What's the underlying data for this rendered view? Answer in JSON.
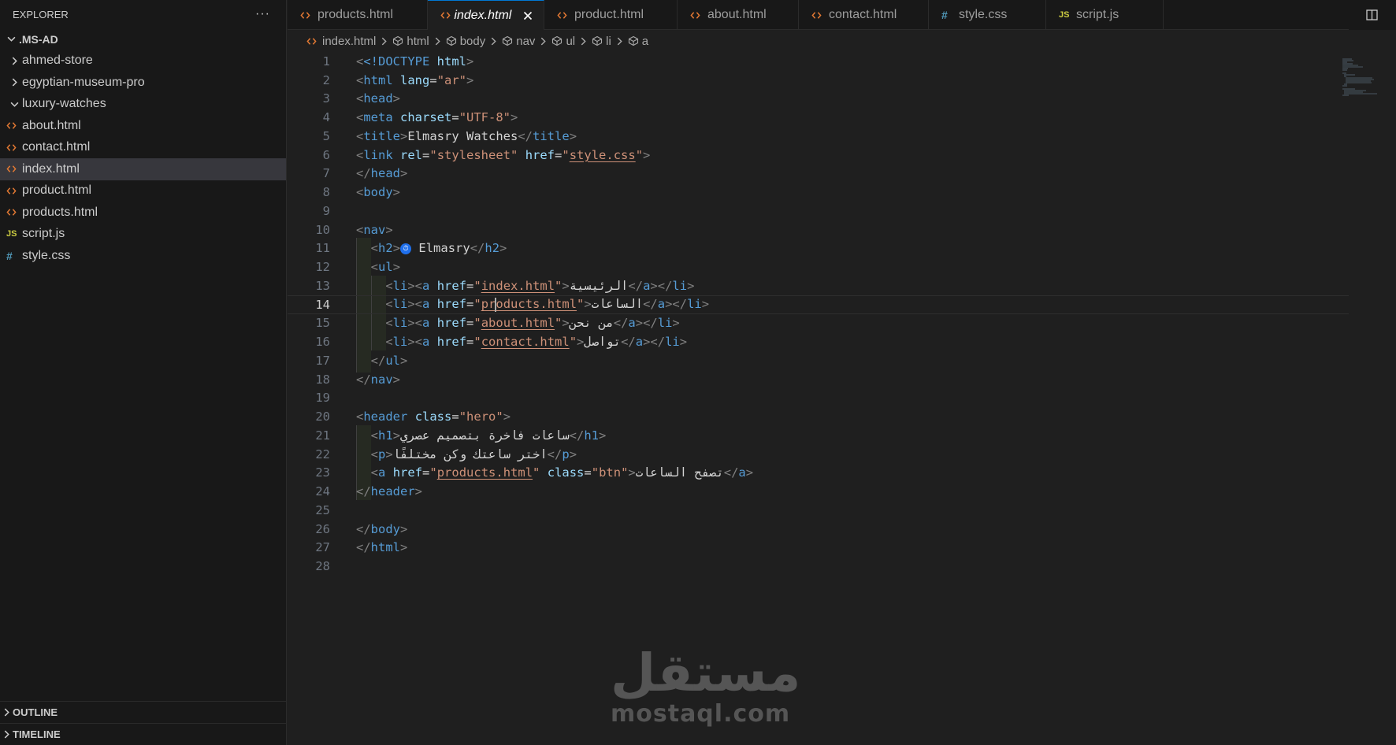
{
  "sidebar": {
    "title": "EXPLORER",
    "more": "···",
    "root": ".MS-AD",
    "folders": [
      {
        "label": "ahmed-store",
        "open": false
      },
      {
        "label": "egyptian-museum-pro",
        "open": false
      },
      {
        "label": "luxury-watches",
        "open": true
      }
    ],
    "files": [
      {
        "label": "about.html",
        "type": "html"
      },
      {
        "label": "contact.html",
        "type": "html"
      },
      {
        "label": "index.html",
        "type": "html",
        "active": true
      },
      {
        "label": "product.html",
        "type": "html"
      },
      {
        "label": "products.html",
        "type": "html"
      },
      {
        "label": "script.js",
        "type": "js"
      },
      {
        "label": "style.css",
        "type": "css"
      }
    ],
    "outline_label": "OUTLINE",
    "timeline_label": "TIMELINE"
  },
  "tabs": [
    {
      "label": "products.html",
      "type": "html"
    },
    {
      "label": "index.html",
      "type": "html",
      "active": true
    },
    {
      "label": "product.html",
      "type": "html"
    },
    {
      "label": "about.html",
      "type": "html"
    },
    {
      "label": "contact.html",
      "type": "html"
    },
    {
      "label": "style.css",
      "type": "css"
    },
    {
      "label": "script.js",
      "type": "js"
    }
  ],
  "breadcrumb": [
    "index.html",
    "html",
    "body",
    "nav",
    "ul",
    "li",
    "a"
  ],
  "editor": {
    "current_line": 14,
    "line_numbers": [
      "1",
      "2",
      "3",
      "4",
      "5",
      "6",
      "7",
      "8",
      "9",
      "10",
      "11",
      "12",
      "13",
      "14",
      "15",
      "16",
      "17",
      "18",
      "19",
      "20",
      "21",
      "22",
      "23",
      "24",
      "25",
      "26",
      "27",
      "28"
    ],
    "code": {
      "doctype": "<!DOCTYPE ",
      "html_kw": "html",
      "lang_val": "\"ar\"",
      "charset_val": "\"UTF-8\"",
      "title_text": "Elmasry Watches",
      "rel_val": "\"stylesheet\"",
      "href_css": "style.css",
      "brand": " Elmasry",
      "href_index": "index.html",
      "href_products_a": "pr",
      "href_products_b": "oducts.html",
      "href_about": "about.html",
      "href_contact": "contact.html",
      "nav_home": "الرئيسية",
      "nav_watches": "الساعات",
      "nav_about": "من نحن",
      "nav_contact": "تواصل",
      "hero_class": "\"hero\"",
      "h1_text": "ساعات فاخرة بتصميم عصري",
      "p_text": "اختر ساعتك وكن مختلفًا",
      "href_products": "products.html",
      "btn_class": "\"btn\"",
      "btn_text": "تصفح الساعات"
    }
  },
  "watermark": {
    "arabic": "مستقل",
    "latin": "mostaql.com"
  },
  "colors": {
    "accent": "#0078d4",
    "tag": "#569cd6",
    "attr": "#9cdcfe",
    "string": "#ce9178",
    "html_icon": "#e37933"
  }
}
